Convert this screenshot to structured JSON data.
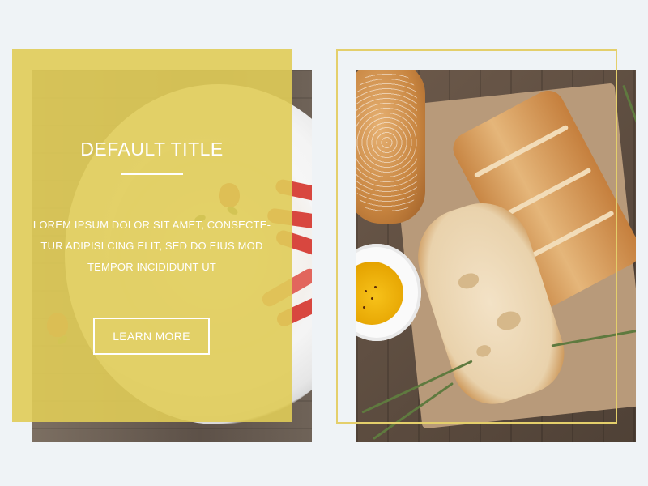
{
  "colors": {
    "background": "#eff3f6",
    "overlay": "#e0cc58",
    "frame": "#e4cf6b",
    "text": "#ffffff"
  },
  "card_left": {
    "title": "DEFAULT TITLE",
    "body": "LOREM IPSUM DOLOR SIT AMET, CONSECTE-TUR ADIPISI CING ELIT, SED DO EIUS MOD TEMPOR INCIDIDUNT UT",
    "button_label": "LEARN MORE",
    "image_subject": "strawberry dessert plate on wooden table"
  },
  "card_right": {
    "image_subject": "bread, olive oil and rosemary on parchment"
  }
}
